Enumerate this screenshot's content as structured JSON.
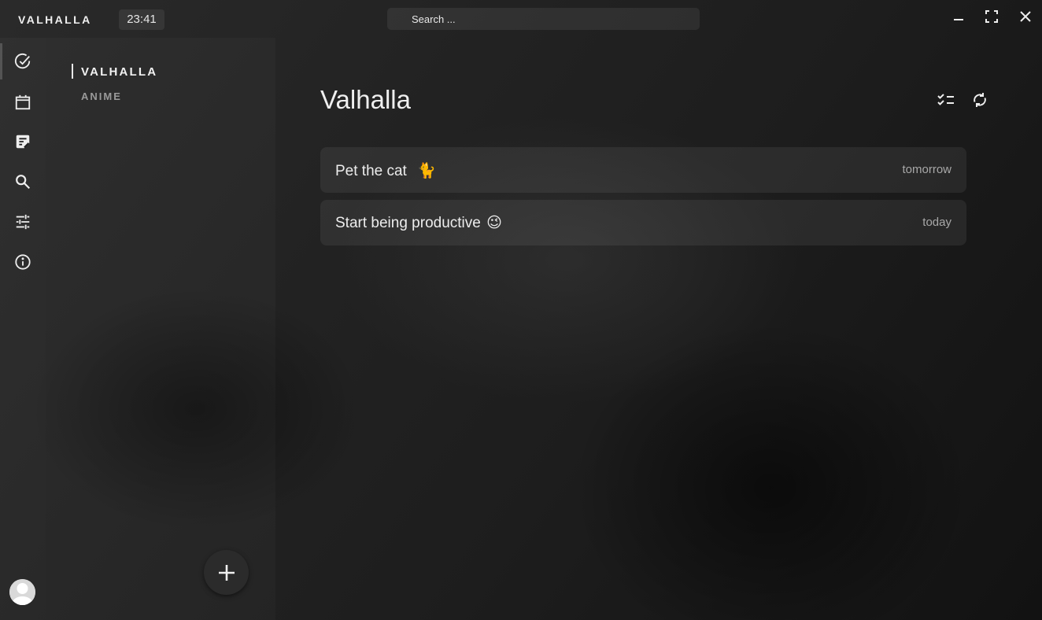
{
  "titlebar": {
    "app_name": "VALHALLA",
    "clock": "23:41",
    "search_placeholder": "Search ...",
    "controls": [
      "minimize-icon",
      "fullscreen-icon",
      "close-icon"
    ]
  },
  "rail": {
    "items": [
      {
        "icon": "check-circle-icon",
        "active": true
      },
      {
        "icon": "calendar-icon",
        "active": false
      },
      {
        "icon": "note-edit-icon",
        "active": false
      },
      {
        "icon": "search-icon",
        "active": false
      },
      {
        "icon": "sliders-icon",
        "active": false
      },
      {
        "icon": "info-icon",
        "active": false
      }
    ],
    "avatar": "avatar-icon"
  },
  "lists": {
    "items": [
      {
        "label": "VALHALLA",
        "active": true
      },
      {
        "label": "ANIME",
        "active": false
      }
    ],
    "add_button_icon": "plus-icon"
  },
  "main": {
    "title": "Valhalla",
    "header_actions": [
      "checklist-icon",
      "sync-icon"
    ],
    "tasks": [
      {
        "title": "Pet the cat",
        "emoji": "🐈",
        "due": "tomorrow"
      },
      {
        "title": "Start being productive",
        "emoji": "😉",
        "due": "today"
      }
    ]
  },
  "colors": {
    "background": "#1e1e1e",
    "card": "#2a2a2a",
    "text": "#ededed",
    "muted": "#a8a8a8",
    "cat_emoji": "#f5b400",
    "wink_emoji": "#f5c000"
  }
}
